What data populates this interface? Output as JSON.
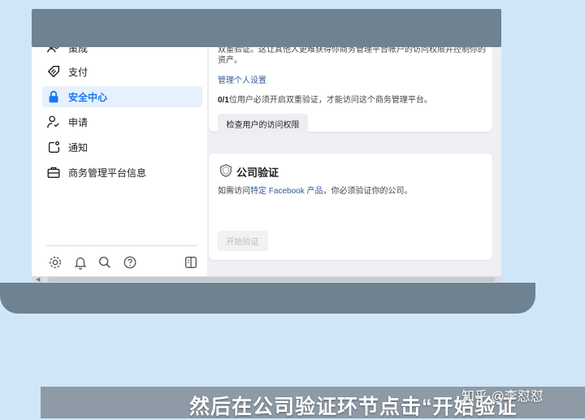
{
  "sidebar": {
    "items": [
      {
        "label": "策成",
        "icon": "users-icon"
      },
      {
        "label": "支付",
        "icon": "tag-icon"
      },
      {
        "label": "安全中心",
        "icon": "lock-icon",
        "active": true
      },
      {
        "label": "申请",
        "icon": "person-check-icon"
      },
      {
        "label": "通知",
        "icon": "notification-icon"
      },
      {
        "label": "商务管理平台信息",
        "icon": "briefcase-icon"
      }
    ],
    "bottom_icons": [
      "settings-icon",
      "bell-icon",
      "search-icon",
      "help-icon",
      "panel-toggle-icon"
    ]
  },
  "two_factor_card": {
    "text_line1": "双重验证。这让其他人更难获得你商务管理平台帐户的访问权限并控制你的",
    "text_line2": "资产。",
    "manage_link": "管理个人设置",
    "count": "0/1",
    "status_text": "位用户必须开启双重验证，才能访问这个商务管理平台。",
    "check_button": "检查用户的访问权限"
  },
  "company_verify_card": {
    "title": "公司验证",
    "desc_prefix": "如需访问",
    "desc_link": "特定 Facebook 产品",
    "desc_suffix": "，你必须验证你的公司。",
    "start_button": "开始验证"
  },
  "subtitle": "然后在公司验证环节点击“开始验证",
  "watermark": "知乎 @李怼怼",
  "colors": {
    "accent": "#1877f2",
    "link": "#385898",
    "laptop": "#6f8292",
    "background": "#cfe6f9"
  }
}
